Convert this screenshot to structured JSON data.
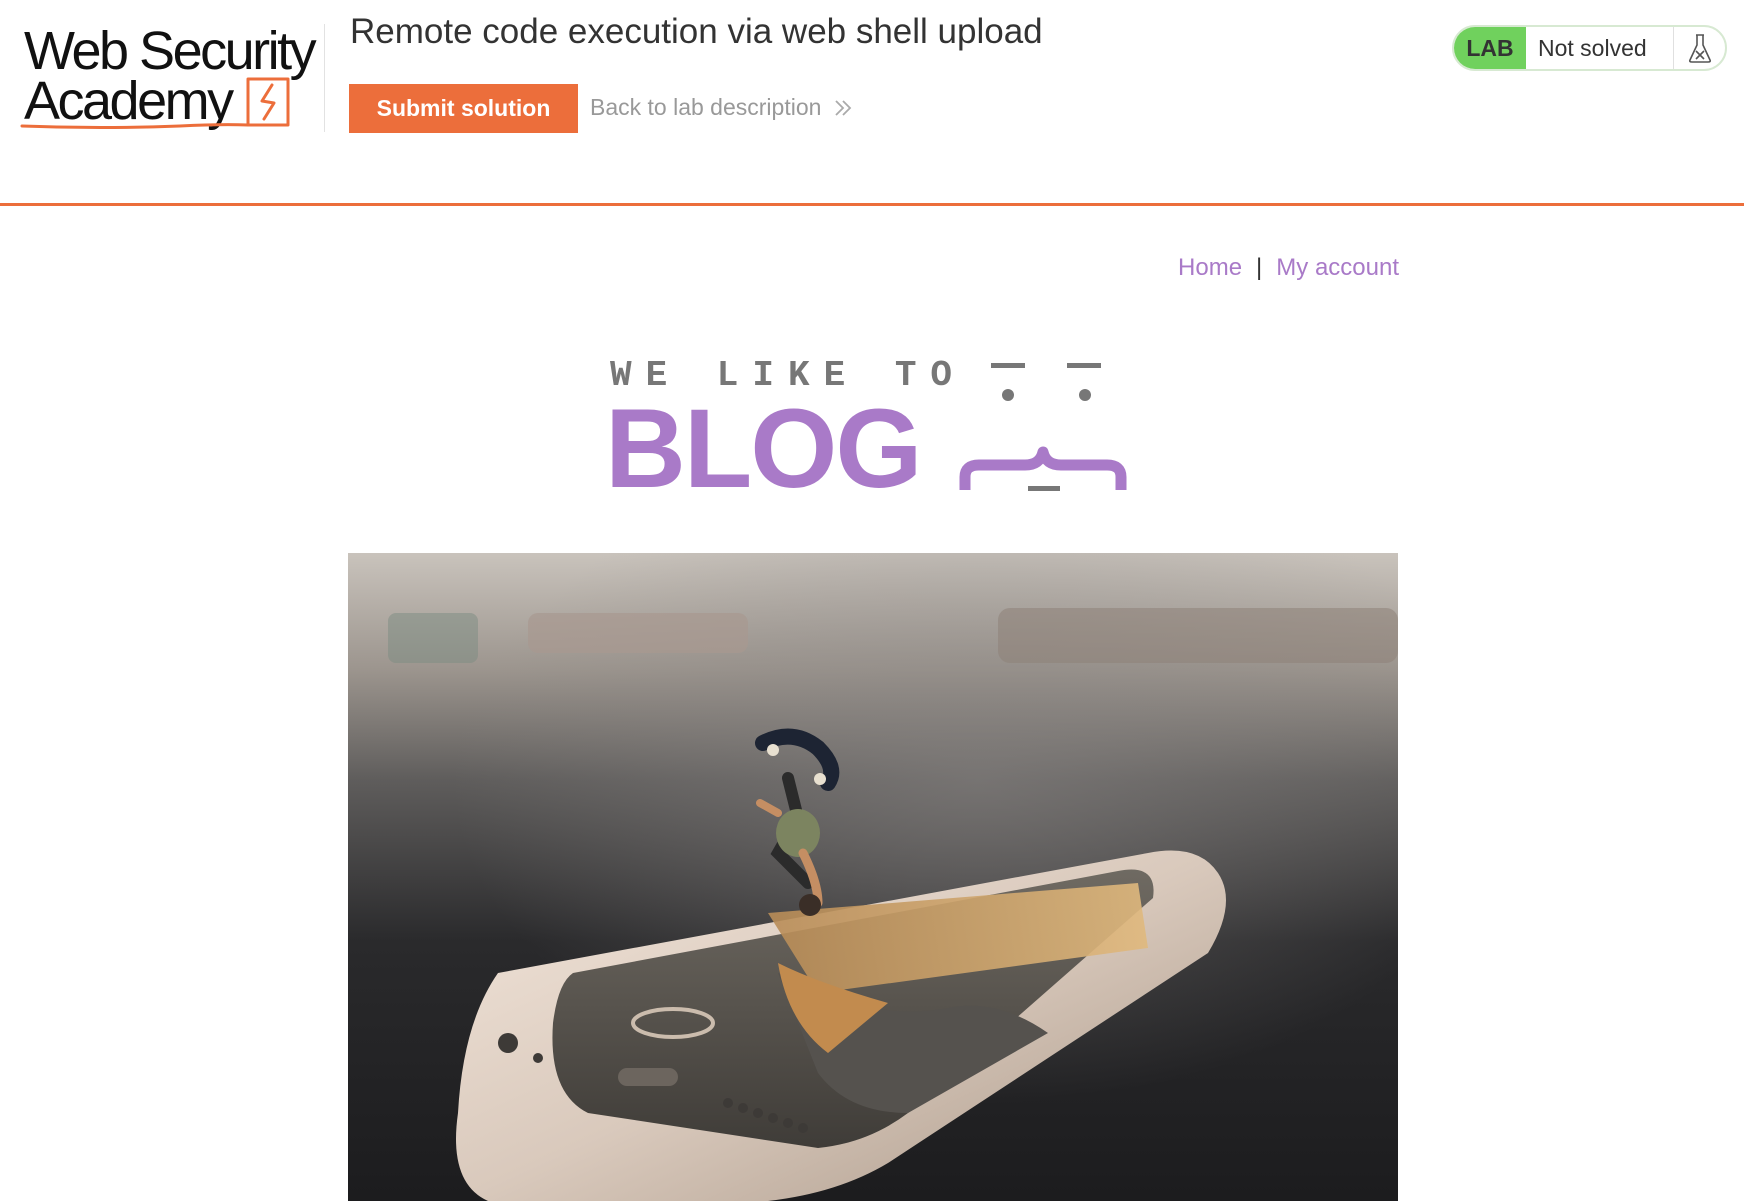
{
  "logo": {
    "line1": "Web Security",
    "line2": "Academy"
  },
  "lab": {
    "title": "Remote code execution via web shell upload",
    "submit_label": "Submit solution",
    "back_label": "Back to lab description",
    "badge": "LAB",
    "status": "Not solved"
  },
  "nav": {
    "home": "Home",
    "separator": "|",
    "account": "My account"
  },
  "banner": {
    "tagline": "WE LIKE TO",
    "word": "BLOG"
  },
  "colors": {
    "accent": "#ec6e3b",
    "purple": "#a97ac8",
    "lab_green": "#70d15d"
  },
  "icons": {
    "back": "double-chevron-right-icon",
    "flask": "flask-icon"
  }
}
